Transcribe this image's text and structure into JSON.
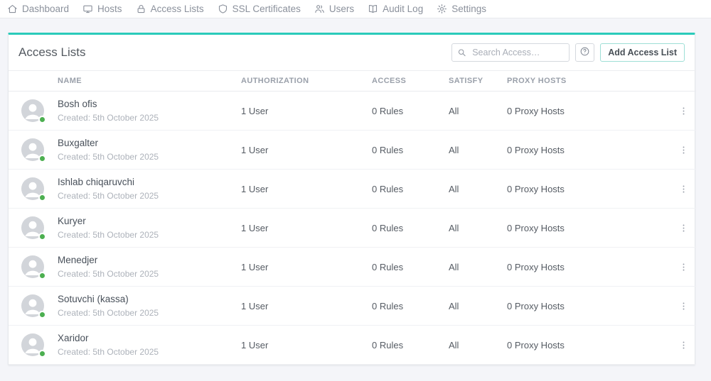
{
  "navbar": {
    "items": [
      {
        "label": "Dashboard",
        "icon": "home-icon"
      },
      {
        "label": "Hosts",
        "icon": "monitor-icon"
      },
      {
        "label": "Access Lists",
        "icon": "lock-icon"
      },
      {
        "label": "SSL Certificates",
        "icon": "shield-icon"
      },
      {
        "label": "Users",
        "icon": "users-icon"
      },
      {
        "label": "Audit Log",
        "icon": "book-icon"
      },
      {
        "label": "Settings",
        "icon": "gear-icon"
      }
    ]
  },
  "card": {
    "title": "Access Lists",
    "search": {
      "placeholder": "Search Access…",
      "value": "",
      "icon": "search-icon"
    },
    "help_button": {
      "icon": "help-circle-icon"
    },
    "add_button_label": "Add Access List"
  },
  "table": {
    "columns": [
      "NAME",
      "AUTHORIZATION",
      "ACCESS",
      "SATISFY",
      "PROXY HOSTS"
    ],
    "rows": [
      {
        "name": "Bosh ofis",
        "created": "Created: 5th October 2025",
        "authorization": "1 User",
        "access": "0 Rules",
        "satisfy": "All",
        "proxy_hosts": "0 Proxy Hosts"
      },
      {
        "name": "Buxgalter",
        "created": "Created: 5th October 2025",
        "authorization": "1 User",
        "access": "0 Rules",
        "satisfy": "All",
        "proxy_hosts": "0 Proxy Hosts"
      },
      {
        "name": "Ishlab chiqaruvchi",
        "created": "Created: 5th October 2025",
        "authorization": "1 User",
        "access": "0 Rules",
        "satisfy": "All",
        "proxy_hosts": "0 Proxy Hosts"
      },
      {
        "name": "Kuryer",
        "created": "Created: 5th October 2025",
        "authorization": "1 User",
        "access": "0 Rules",
        "satisfy": "All",
        "proxy_hosts": "0 Proxy Hosts"
      },
      {
        "name": "Menedjer",
        "created": "Created: 5th October 2025",
        "authorization": "1 User",
        "access": "0 Rules",
        "satisfy": "All",
        "proxy_hosts": "0 Proxy Hosts"
      },
      {
        "name": "Sotuvchi (kassa)",
        "created": "Created: 5th October 2025",
        "authorization": "1 User",
        "access": "0 Rules",
        "satisfy": "All",
        "proxy_hosts": "0 Proxy Hosts"
      },
      {
        "name": "Xaridor",
        "created": "Created: 5th October 2025",
        "authorization": "1 User",
        "access": "0 Rules",
        "satisfy": "All",
        "proxy_hosts": "0 Proxy Hosts"
      }
    ],
    "row_avatar_icon": "default-avatar-icon",
    "row_status_icon": "online-status-dot",
    "row_menu_icon": "kebab-menu-icon"
  },
  "colors": {
    "accent_teal": "#2bcbba",
    "status_green": "#4caf50"
  }
}
